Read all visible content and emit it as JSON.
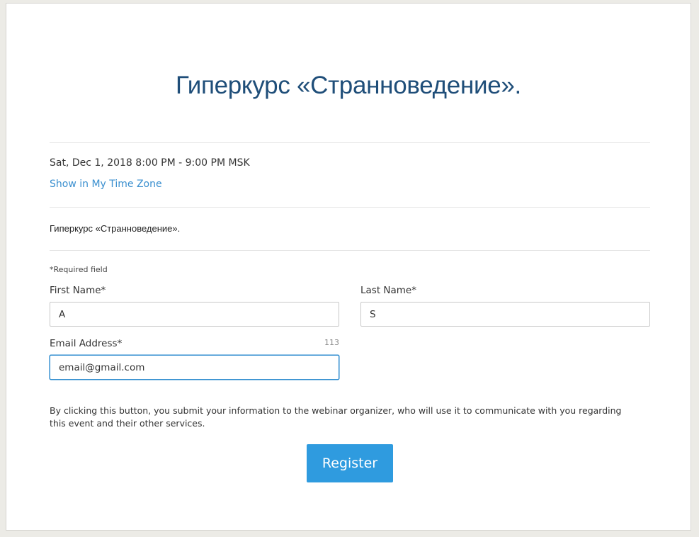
{
  "event": {
    "title": "Гиперкурс «Странноведение».",
    "datetime": "Sat, Dec 1, 2018 8:00 PM - 9:00 PM MSK",
    "timezone_link": "Show in My Time Zone",
    "description": "Гиперкурс «Странноведение»."
  },
  "form": {
    "required_note": "*Required field",
    "first_name": {
      "label": "First Name*",
      "value": "A"
    },
    "last_name": {
      "label": "Last Name*",
      "value": "S"
    },
    "email": {
      "label": "Email Address*",
      "value": "email@gmail.com",
      "counter": "113"
    },
    "consent": "By clicking this button, you submit your information to the webinar organizer, who will use it to communicate with you regarding this event and their other services.",
    "register_label": "Register"
  },
  "colors": {
    "title": "#1f4e79",
    "link": "#3a8fcf",
    "button": "#2f9bdf",
    "focus_border": "#2f8ccf",
    "page_background": "#ecebe6"
  }
}
